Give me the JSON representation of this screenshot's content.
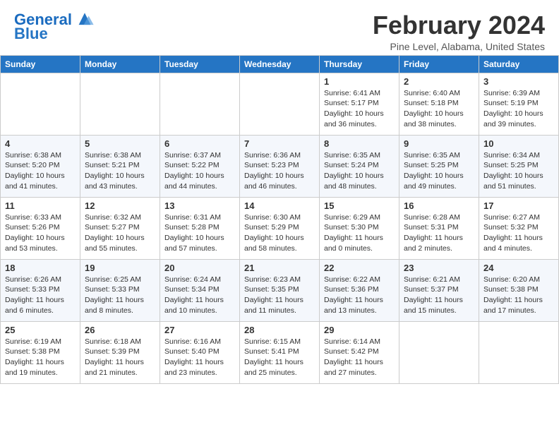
{
  "header": {
    "logo_line1": "General",
    "logo_line2": "Blue",
    "month": "February 2024",
    "location": "Pine Level, Alabama, United States"
  },
  "days_of_week": [
    "Sunday",
    "Monday",
    "Tuesday",
    "Wednesday",
    "Thursday",
    "Friday",
    "Saturday"
  ],
  "weeks": [
    [
      {
        "day": "",
        "info": ""
      },
      {
        "day": "",
        "info": ""
      },
      {
        "day": "",
        "info": ""
      },
      {
        "day": "",
        "info": ""
      },
      {
        "day": "1",
        "info": "Sunrise: 6:41 AM\nSunset: 5:17 PM\nDaylight: 10 hours\nand 36 minutes."
      },
      {
        "day": "2",
        "info": "Sunrise: 6:40 AM\nSunset: 5:18 PM\nDaylight: 10 hours\nand 38 minutes."
      },
      {
        "day": "3",
        "info": "Sunrise: 6:39 AM\nSunset: 5:19 PM\nDaylight: 10 hours\nand 39 minutes."
      }
    ],
    [
      {
        "day": "4",
        "info": "Sunrise: 6:38 AM\nSunset: 5:20 PM\nDaylight: 10 hours\nand 41 minutes."
      },
      {
        "day": "5",
        "info": "Sunrise: 6:38 AM\nSunset: 5:21 PM\nDaylight: 10 hours\nand 43 minutes."
      },
      {
        "day": "6",
        "info": "Sunrise: 6:37 AM\nSunset: 5:22 PM\nDaylight: 10 hours\nand 44 minutes."
      },
      {
        "day": "7",
        "info": "Sunrise: 6:36 AM\nSunset: 5:23 PM\nDaylight: 10 hours\nand 46 minutes."
      },
      {
        "day": "8",
        "info": "Sunrise: 6:35 AM\nSunset: 5:24 PM\nDaylight: 10 hours\nand 48 minutes."
      },
      {
        "day": "9",
        "info": "Sunrise: 6:35 AM\nSunset: 5:25 PM\nDaylight: 10 hours\nand 49 minutes."
      },
      {
        "day": "10",
        "info": "Sunrise: 6:34 AM\nSunset: 5:25 PM\nDaylight: 10 hours\nand 51 minutes."
      }
    ],
    [
      {
        "day": "11",
        "info": "Sunrise: 6:33 AM\nSunset: 5:26 PM\nDaylight: 10 hours\nand 53 minutes."
      },
      {
        "day": "12",
        "info": "Sunrise: 6:32 AM\nSunset: 5:27 PM\nDaylight: 10 hours\nand 55 minutes."
      },
      {
        "day": "13",
        "info": "Sunrise: 6:31 AM\nSunset: 5:28 PM\nDaylight: 10 hours\nand 57 minutes."
      },
      {
        "day": "14",
        "info": "Sunrise: 6:30 AM\nSunset: 5:29 PM\nDaylight: 10 hours\nand 58 minutes."
      },
      {
        "day": "15",
        "info": "Sunrise: 6:29 AM\nSunset: 5:30 PM\nDaylight: 11 hours\nand 0 minutes."
      },
      {
        "day": "16",
        "info": "Sunrise: 6:28 AM\nSunset: 5:31 PM\nDaylight: 11 hours\nand 2 minutes."
      },
      {
        "day": "17",
        "info": "Sunrise: 6:27 AM\nSunset: 5:32 PM\nDaylight: 11 hours\nand 4 minutes."
      }
    ],
    [
      {
        "day": "18",
        "info": "Sunrise: 6:26 AM\nSunset: 5:33 PM\nDaylight: 11 hours\nand 6 minutes."
      },
      {
        "day": "19",
        "info": "Sunrise: 6:25 AM\nSunset: 5:33 PM\nDaylight: 11 hours\nand 8 minutes."
      },
      {
        "day": "20",
        "info": "Sunrise: 6:24 AM\nSunset: 5:34 PM\nDaylight: 11 hours\nand 10 minutes."
      },
      {
        "day": "21",
        "info": "Sunrise: 6:23 AM\nSunset: 5:35 PM\nDaylight: 11 hours\nand 11 minutes."
      },
      {
        "day": "22",
        "info": "Sunrise: 6:22 AM\nSunset: 5:36 PM\nDaylight: 11 hours\nand 13 minutes."
      },
      {
        "day": "23",
        "info": "Sunrise: 6:21 AM\nSunset: 5:37 PM\nDaylight: 11 hours\nand 15 minutes."
      },
      {
        "day": "24",
        "info": "Sunrise: 6:20 AM\nSunset: 5:38 PM\nDaylight: 11 hours\nand 17 minutes."
      }
    ],
    [
      {
        "day": "25",
        "info": "Sunrise: 6:19 AM\nSunset: 5:38 PM\nDaylight: 11 hours\nand 19 minutes."
      },
      {
        "day": "26",
        "info": "Sunrise: 6:18 AM\nSunset: 5:39 PM\nDaylight: 11 hours\nand 21 minutes."
      },
      {
        "day": "27",
        "info": "Sunrise: 6:16 AM\nSunset: 5:40 PM\nDaylight: 11 hours\nand 23 minutes."
      },
      {
        "day": "28",
        "info": "Sunrise: 6:15 AM\nSunset: 5:41 PM\nDaylight: 11 hours\nand 25 minutes."
      },
      {
        "day": "29",
        "info": "Sunrise: 6:14 AM\nSunset: 5:42 PM\nDaylight: 11 hours\nand 27 minutes."
      },
      {
        "day": "",
        "info": ""
      },
      {
        "day": "",
        "info": ""
      }
    ]
  ]
}
